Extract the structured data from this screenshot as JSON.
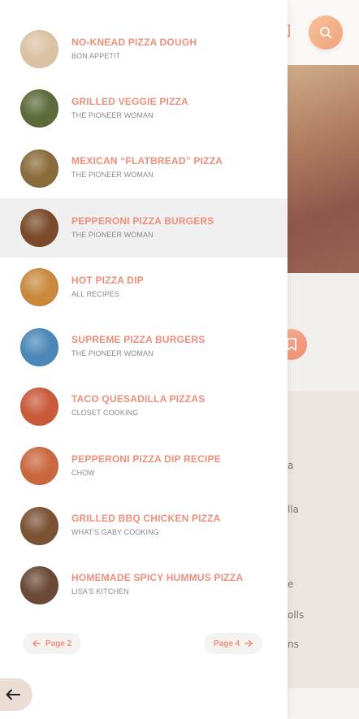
{
  "background": {
    "fragments": [
      "a",
      "lla",
      "e",
      "olls",
      "ns"
    ]
  },
  "recipes": [
    {
      "title": "NO-KNEAD PIZZA DOUGH",
      "source": "BON APPETIT",
      "thumb_color": "#dcc2a4",
      "active": false
    },
    {
      "title": "GRILLED VEGGIE PIZZA",
      "source": "THE PIONEER WOMAN",
      "thumb_color": "#5d6a3a",
      "active": false
    },
    {
      "title": "MEXICAN “FLATBREAD” PIZZA",
      "source": "THE PIONEER WOMAN",
      "thumb_color": "#8a6b3c",
      "active": false
    },
    {
      "title": "PEPPERONI PIZZA BURGERS",
      "source": "THE PIONEER WOMAN",
      "thumb_color": "#7a4a2a",
      "active": true
    },
    {
      "title": "HOT PIZZA DIP",
      "source": "ALL RECIPES",
      "thumb_color": "#c98a3e",
      "active": false
    },
    {
      "title": "SUPREME PIZZA BURGERS",
      "source": "THE PIONEER WOMAN",
      "thumb_color": "#4c88b7",
      "active": false
    },
    {
      "title": "TACO QUESADILLA PIZZAS",
      "source": "CLOSET COOKING",
      "thumb_color": "#c95a3a",
      "active": false
    },
    {
      "title": "PEPPERONI PIZZA DIP RECIPE",
      "source": "CHOW",
      "thumb_color": "#c9683f",
      "active": false
    },
    {
      "title": "GRILLED BBQ CHICKEN PIZZA",
      "source": "WHAT'S GABY COOKING",
      "thumb_color": "#7a5234",
      "active": false
    },
    {
      "title": "HOMEMADE SPICY HUMMUS PIZZA",
      "source": "LISA'S KITCHEN",
      "thumb_color": "#6a4a36",
      "active": false
    }
  ],
  "pagination": {
    "prev_label": "Page 2",
    "next_label": "Page 4"
  },
  "colors": {
    "accent": "#ef8f7b",
    "active_row": "#f0f0f0"
  },
  "icons": {
    "search": "search-icon",
    "bookmark": "bookmark-icon",
    "back": "arrow-left-icon"
  }
}
